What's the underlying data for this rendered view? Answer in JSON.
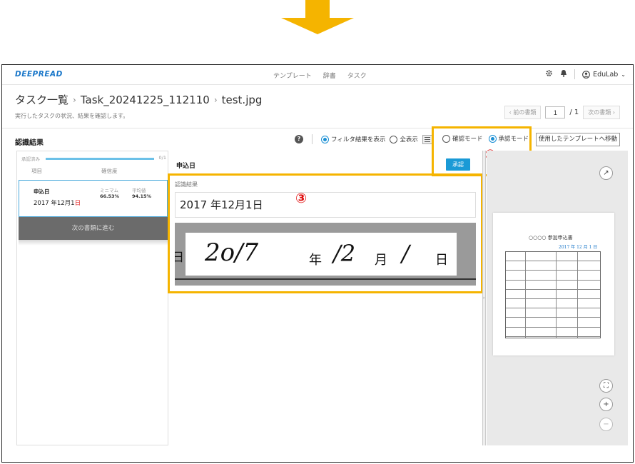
{
  "app": {
    "logo": "DEEPREAD",
    "nav": [
      "テンプレート",
      "辞書",
      "タスク"
    ],
    "user": "EduLab"
  },
  "page": {
    "breadcrumb_root": "タスク一覧",
    "breadcrumb_task": "Task_20241225_112110",
    "breadcrumb_file": "test.jpg",
    "subtitle": "実行したタスクの状況、結果を確認します。"
  },
  "pager": {
    "prev": "前の書類",
    "current": "1",
    "total": "/ 1",
    "next": "次の書類"
  },
  "section_title": "認識結果",
  "toolbar": {
    "filter_label": "フィルタ結果を表示",
    "show_all_label": "全表示",
    "filter_selected": true
  },
  "modes": {
    "confirm_label": "確認モード",
    "approve_label": "承認モード",
    "selected": "approve",
    "approve_button": "承認",
    "annotation": "④"
  },
  "template_button": "使用したテンプレートへ移動",
  "left_panel": {
    "progress_label": "承認済み",
    "progress_count": "0/1",
    "progress_fraction": 1.0,
    "col_item": "項目",
    "col_confidence": "確信度",
    "row": {
      "name": "申込日",
      "value_prefix": "2017 年12月1",
      "value_red": "日",
      "min_label": "ミニマム",
      "min_value": "66.53%",
      "avg_label": "平均値",
      "avg_value": "94.15%"
    },
    "next_button": "次の書類に進む"
  },
  "center": {
    "field_title": "申込日",
    "result_label": "認識結果",
    "result_value": "2017 年12月1日",
    "annotation": "③",
    "handwriting": {
      "day_left": "日",
      "year": "2o/7",
      "nen": "年",
      "month": "/2",
      "tsuki": "月",
      "day": "/",
      "hi": "日"
    }
  },
  "document": {
    "title": "○○○○ 参加申込書",
    "date_stamp": "2017 年 12 月 1 日"
  },
  "colors": {
    "accent": "#1a9ad6",
    "highlight": "#f5b400",
    "annotation": "#e01010",
    "arrow": "#f5b400"
  }
}
